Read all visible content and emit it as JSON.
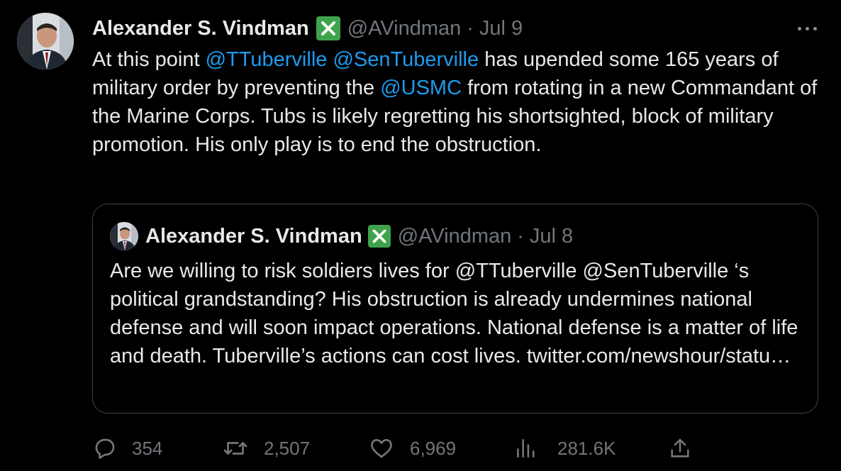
{
  "tweet": {
    "author_name": "Alexander S. Vindman",
    "handle": "@AVindman",
    "separator": "·",
    "date": "Jul 9",
    "body_segments": [
      {
        "text": "At this point ",
        "mention": false
      },
      {
        "text": "@TTuberville",
        "mention": true
      },
      {
        "text": " ",
        "mention": false
      },
      {
        "text": "@SenTuberville",
        "mention": true
      },
      {
        "text": " has upended some 165 years of military order by preventing the ",
        "mention": false
      },
      {
        "text": "@USMC",
        "mention": true
      },
      {
        "text": " from rotating in a new Commandant of the Marine Corps. Tubs is likely regretting his shortsighted, block of military promotion. His only play is to end the obstruction.",
        "mention": false
      }
    ]
  },
  "quoted_tweet": {
    "author_name": "Alexander S. Vindman",
    "handle": "@AVindman",
    "separator": "·",
    "date": "Jul 8",
    "body": "Are we willing to risk soldiers lives for @TTuberville @SenTuberville ‘s political grandstanding? His obstruction is already undermines national defense and will soon impact operations. National defense is a matter of life and death. Tuberville’s actions can cost lives. twitter.com/newshour/statu…"
  },
  "actions": {
    "replies": "354",
    "reposts": "2,507",
    "likes": "6,969",
    "views": "281.6K"
  },
  "colors": {
    "background": "#000000",
    "text": "#e7e9ea",
    "muted": "#71767b",
    "link": "#1d9bf0",
    "badge": "#3fa34d"
  },
  "icons": [
    "avatar",
    "verified-badge-icon",
    "more-icon",
    "reply-icon",
    "repost-icon",
    "like-icon",
    "views-icon",
    "share-icon"
  ]
}
